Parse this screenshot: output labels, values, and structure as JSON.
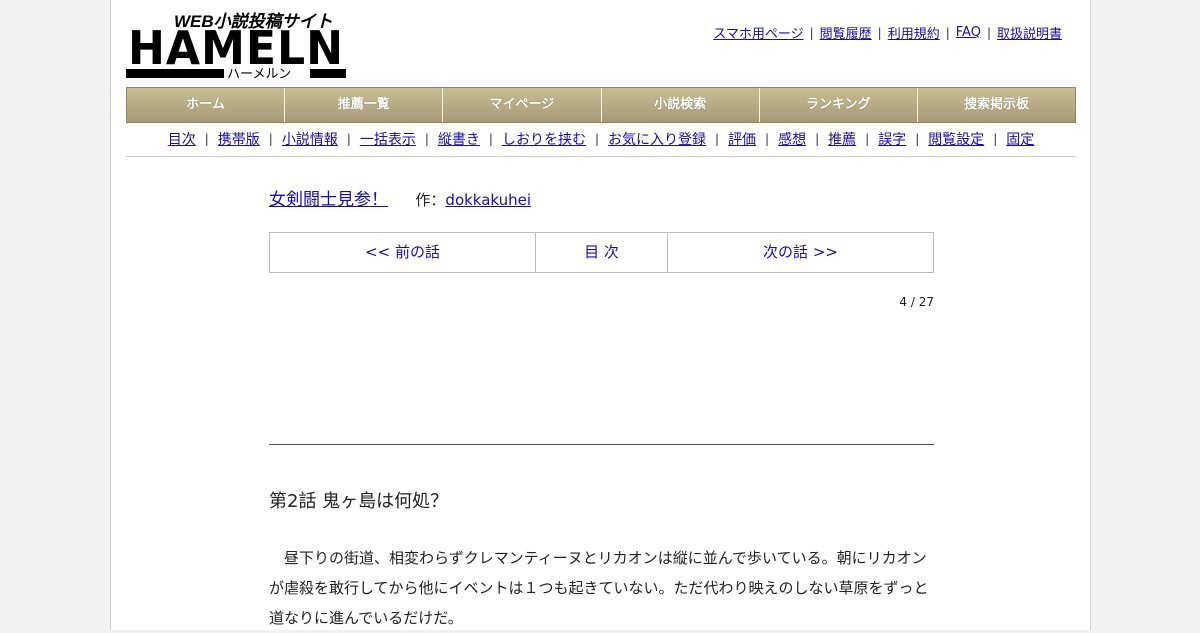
{
  "logo": {
    "text": "HAMELN",
    "tagline": "WEB小説投稿サイト",
    "kana": "ハーメルン"
  },
  "top_links": [
    "スマホ用ページ",
    "閲覧履歴",
    "利用規約",
    "FAQ",
    "取扱説明書"
  ],
  "menu": [
    "ホーム",
    "推薦一覧",
    "マイページ",
    "小説検索",
    "ランキング",
    "捜索掲示板"
  ],
  "subnav": [
    "目次",
    "携帯版",
    "小説情報",
    "一括表示",
    "縦書き",
    "しおりを挟む",
    "お気に入り登録",
    "評価",
    "感想",
    "推薦",
    "誤字",
    "閲覧設定",
    "固定"
  ],
  "novel": {
    "title": "女剣闘士見参！",
    "author_label": "作：",
    "author": "dokkakuhei"
  },
  "nav": {
    "prev": "<< 前の話",
    "toc": "目 次",
    "next": "次の話 >>"
  },
  "page_count": "4 / 27",
  "chapter_title": "第2話 鬼ヶ島は何処？",
  "body": "昼下りの街道、相変わらずクレマンティーヌとリカオンは縦に並んで歩いている。朝にリカオンが虐殺を敢行してから他にイベントは１つも起きていない。ただ代わり映えのしない草原をずっと道なりに進んでいるだけだ。",
  "colors": {
    "link": "#1a0dab",
    "menu": "#b3a880"
  }
}
